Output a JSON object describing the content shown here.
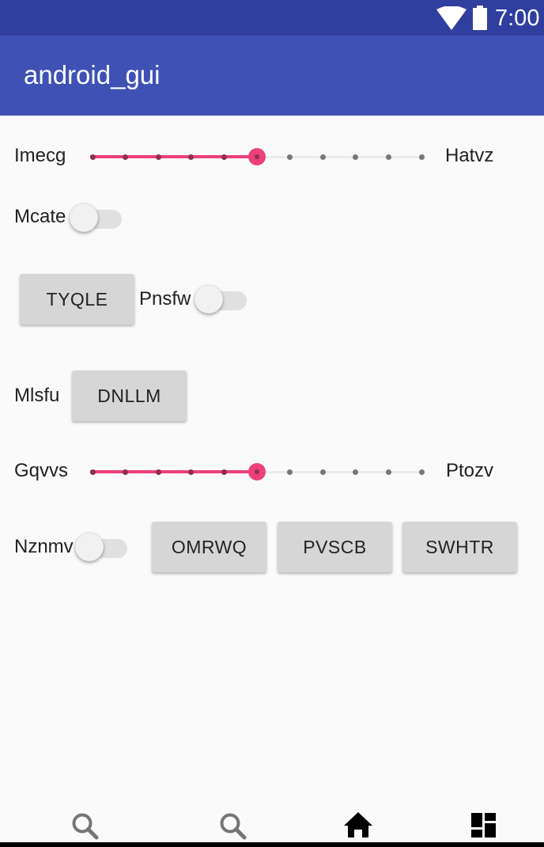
{
  "status_bar": {
    "time": "7:00",
    "icons": [
      "wifi-icon",
      "battery-icon"
    ],
    "color": "#303f9f"
  },
  "app_bar": {
    "title": "android_gui",
    "color": "#3f51b5"
  },
  "seekbar1": {
    "left_label": "Imecg",
    "right_label": "Hatvz",
    "max": 10,
    "value": 5
  },
  "switch1": {
    "label": "Mcate",
    "checked": false
  },
  "row3": {
    "button_label": "TYQLE",
    "switch_label": "Pnsfw",
    "switch_checked": false
  },
  "row4": {
    "label": "Mlsfu",
    "button_label": "DNLLM"
  },
  "seekbar2": {
    "left_label": "Gqvvs",
    "right_label": "Ptozv",
    "max": 10,
    "value": 5
  },
  "row6": {
    "switch_label": "Nznmv",
    "switch_checked": false,
    "buttons": [
      "OMRWQ",
      "PVSCB",
      "SWHTR"
    ]
  },
  "bottom_nav": {
    "items": [
      "search-icon",
      "search-icon",
      "home-icon",
      "dashboard-icon"
    ]
  },
  "accent_color": "#ec407a"
}
